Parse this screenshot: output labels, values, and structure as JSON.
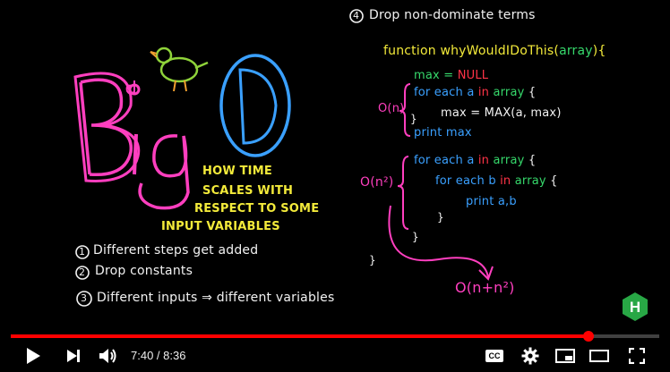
{
  "video": {
    "title_big": "BigO",
    "subtitle": [
      "HOW TIME",
      "SCALES WITH",
      "RESPECT TO SOME",
      "INPUT VARIABLES"
    ],
    "rules": [
      {
        "num": "1",
        "text": "Different steps get added"
      },
      {
        "num": "2",
        "text": "Drop constants"
      },
      {
        "num": "3",
        "text": "Different inputs ⇒ different variables"
      },
      {
        "num": "4",
        "text": "Drop non-dominate terms"
      }
    ],
    "code": {
      "kw_function": "function",
      "fn_name": "whyWouldIDoThis",
      "fn_args_open": "(",
      "fn_arg": "array",
      "fn_args_close": ")",
      "brace_open": "{",
      "max_var": "max",
      "max_eq": "=",
      "max_null": "NULL",
      "on_label": "O(n)",
      "loop1_for": "for each",
      "loop1_a": "a",
      "loop1_in": "in",
      "loop1_array": "array",
      "loop1_brace": "{",
      "loop1_body": "max = MAX(a, max)",
      "loop1_close": "}",
      "print_max": "print max",
      "on2_label": "O(n²)",
      "loop2_for": "for each",
      "loop2_a": "a",
      "loop2_in": "in",
      "loop2_array": "array",
      "loop2_brace": "{",
      "loop3_for": "for each",
      "loop3_b": "b",
      "loop3_in": "in",
      "loop3_array": "array",
      "loop3_brace": "{",
      "loop3_body": "print a,b",
      "close1": "}",
      "close2": "}",
      "close3": "}",
      "result": "O(n+n²)"
    },
    "badge_letter": "H"
  },
  "player": {
    "time_current": "7:40",
    "time_separator": " / ",
    "time_total": "8:36",
    "progress_fraction": 0.891,
    "colors": {
      "progress": "#ff0000",
      "background": "#000000"
    },
    "icons": [
      "play-icon",
      "next-icon",
      "volume-icon",
      "captions-icon",
      "settings-icon",
      "miniplayer-icon",
      "theater-icon",
      "fullscreen-icon"
    ],
    "cc_label": "CC"
  }
}
